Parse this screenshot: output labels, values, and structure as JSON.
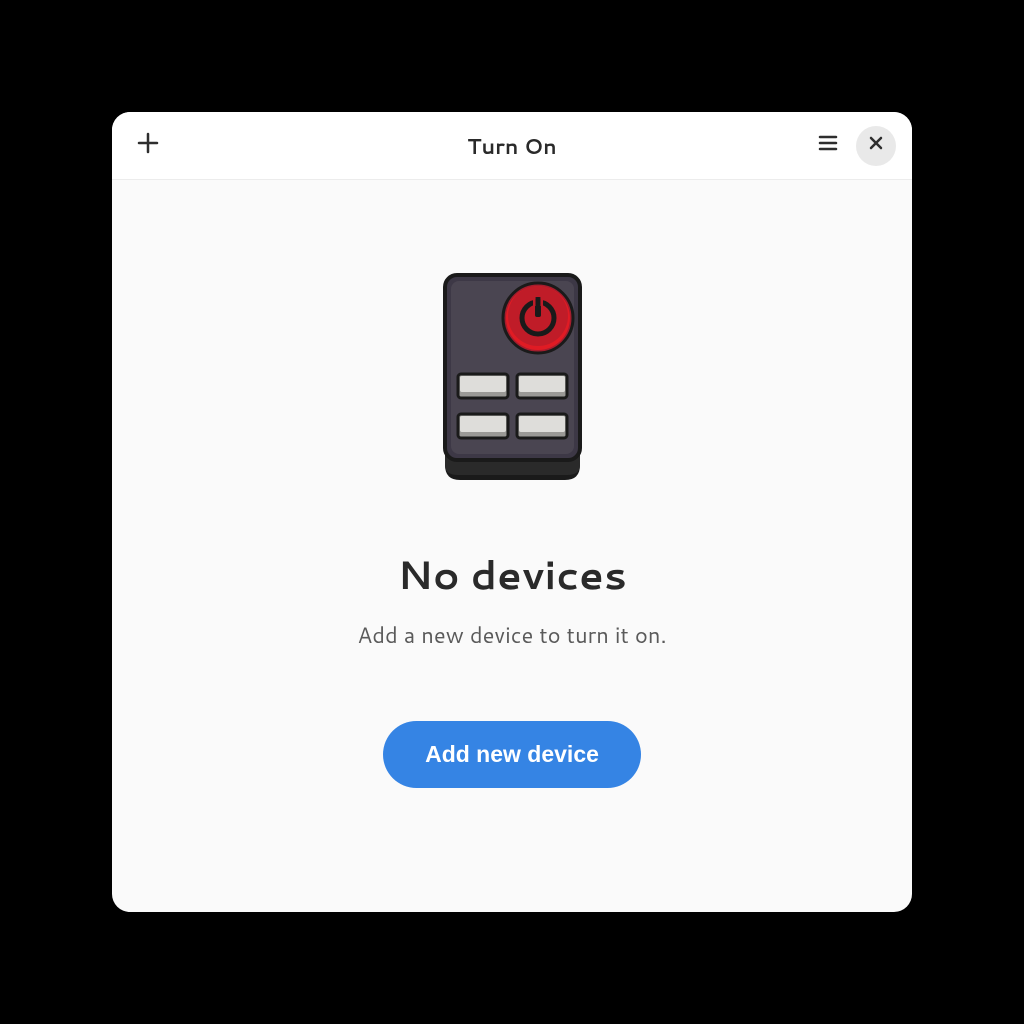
{
  "header": {
    "title": "Turn On"
  },
  "empty_state": {
    "heading": "No devices",
    "subtext": "Add a new device to turn it on.",
    "button_label": "Add new device"
  },
  "colors": {
    "accent": "#3584e4",
    "power_red": "#c01c28"
  }
}
